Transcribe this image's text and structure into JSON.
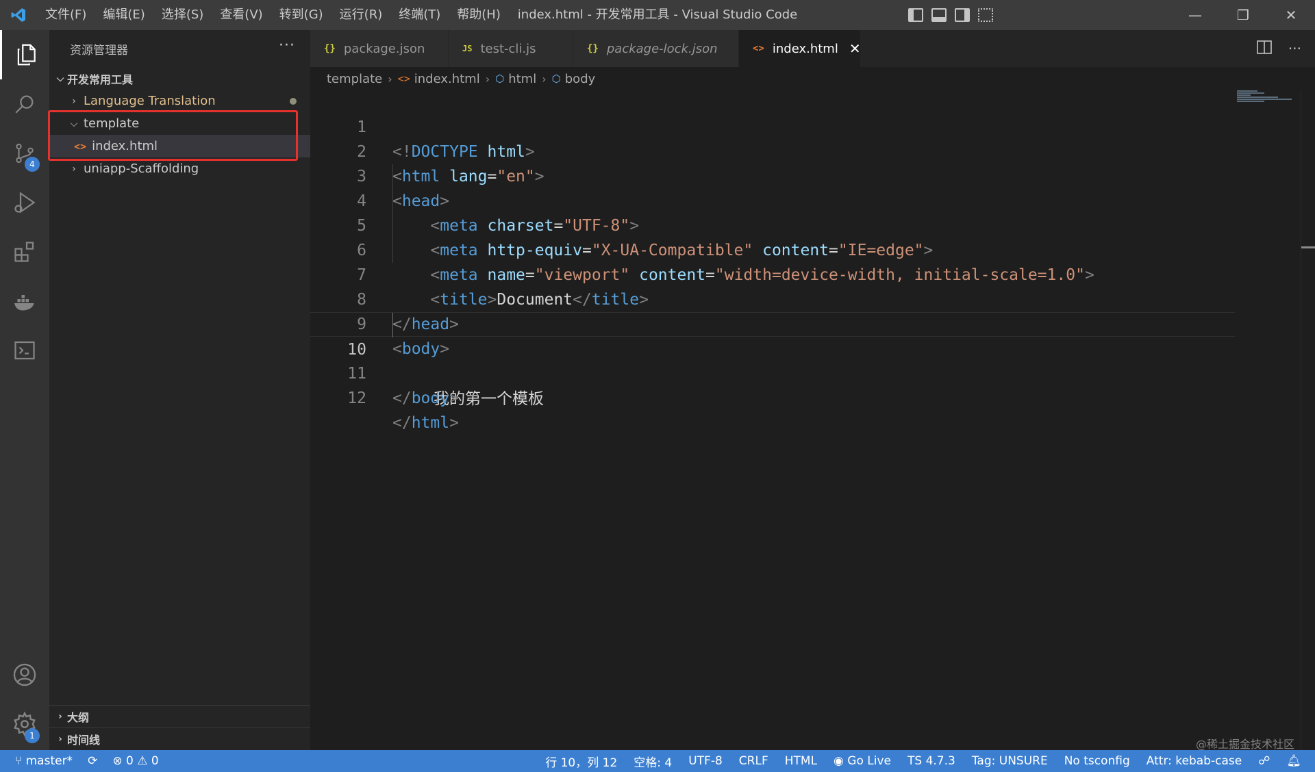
{
  "window": {
    "title": "index.html - 开发常用工具 - Visual Studio Code",
    "minimize": "—",
    "restore": "❐",
    "close": "✕"
  },
  "menu": [
    "文件(F)",
    "编辑(E)",
    "选择(S)",
    "查看(V)",
    "转到(G)",
    "运行(R)",
    "终端(T)",
    "帮助(H)"
  ],
  "activity": {
    "scm_badge": "4",
    "settings_badge": "1"
  },
  "sidebar": {
    "header": "资源管理器",
    "more": "···",
    "workspace": "开发常用工具",
    "items": [
      {
        "label": "Language Translation"
      },
      {
        "label": "template"
      },
      {
        "label": "index.html"
      },
      {
        "label": "uniapp-Scaffolding"
      }
    ],
    "outline": "大纲",
    "timeline": "时间线"
  },
  "tabs": [
    {
      "label": "package.json",
      "icon": "{}"
    },
    {
      "label": "test-cli.js",
      "icon": "JS"
    },
    {
      "label": "package-lock.json",
      "icon": "{}"
    },
    {
      "label": "index.html",
      "icon": "<>",
      "close": "✕"
    }
  ],
  "breadcrumb": [
    "template",
    "index.html",
    "html",
    "body"
  ],
  "editor": {
    "line_numbers": [
      "1",
      "2",
      "3",
      "4",
      "5",
      "6",
      "7",
      "8",
      "9",
      "10",
      "11",
      "12"
    ],
    "current_line": "10",
    "line10_text": "我的第一个模板",
    "title_text": "Document"
  },
  "status": {
    "branch": "master*",
    "errors": "0",
    "warnings": "0",
    "position": "行 10，列 12",
    "spaces": "空格: 4",
    "encoding": "UTF-8",
    "eol": "CRLF",
    "language": "HTML",
    "golive": "Go Live",
    "ts": "TS 4.7.3",
    "tag": "Tag: UNSURE",
    "tsconfig": "No tsconfig",
    "attr": "Attr: kebab-case"
  },
  "watermark": "@稀土掘金技术社区"
}
